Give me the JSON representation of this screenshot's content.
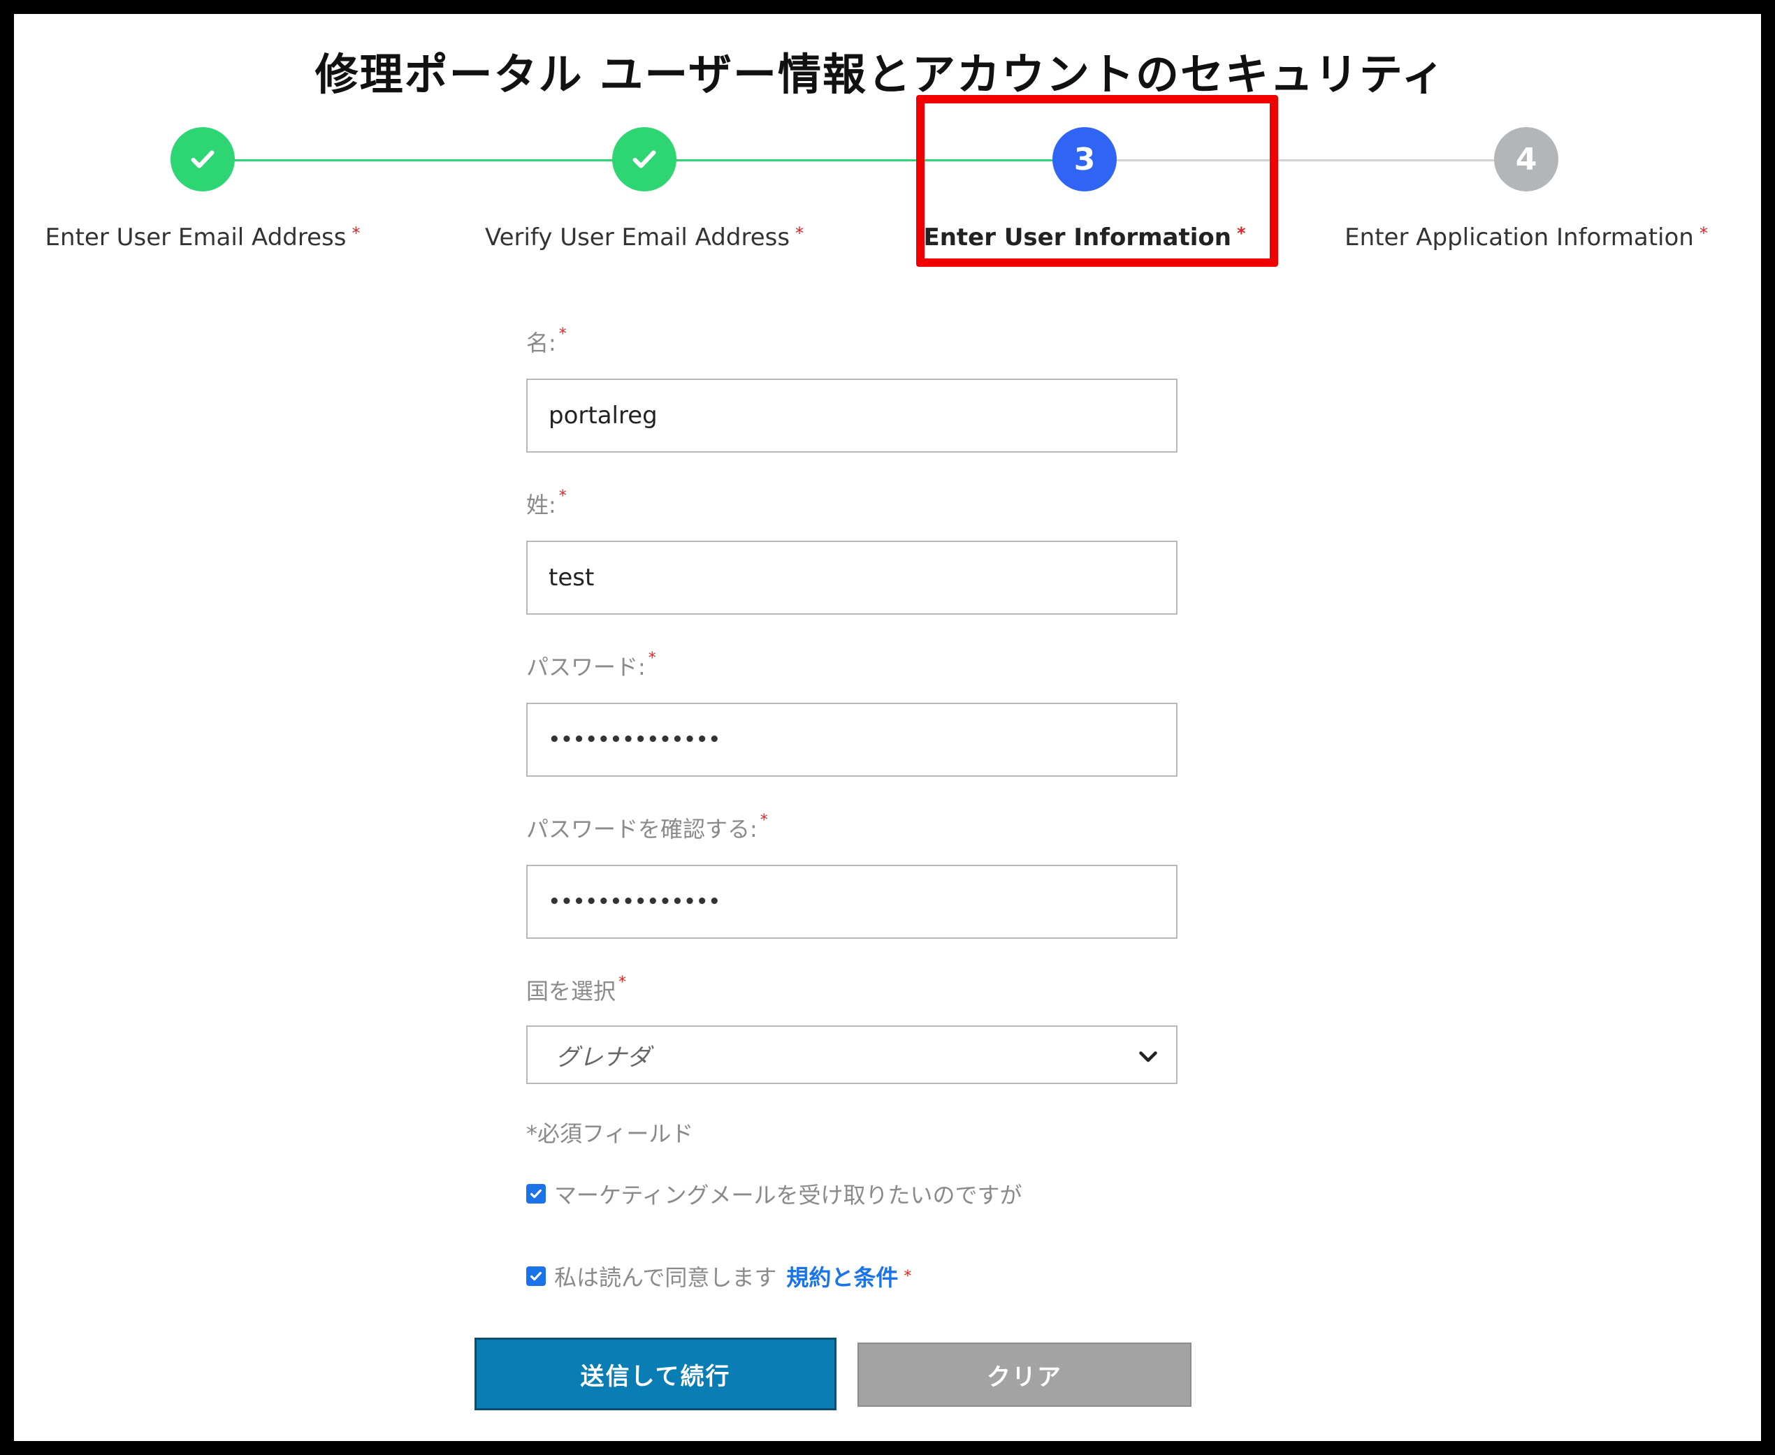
{
  "page": {
    "title": "修理ポータル ユーザー情報とアカウントのセキュリティ"
  },
  "stepper": {
    "required_mark": "*",
    "colors": {
      "done": "#2ed573",
      "active": "#2f64f5",
      "pending": "#b3b6b9"
    },
    "steps": [
      {
        "label": "Enter User Email Address",
        "status": "done",
        "icon": "check-icon"
      },
      {
        "label": "Verify User Email Address",
        "status": "done",
        "icon": "check-icon"
      },
      {
        "label": "Enter User Information",
        "number": "3",
        "status": "active"
      },
      {
        "label": "Enter Application Information",
        "number": "4",
        "status": "pending"
      }
    ]
  },
  "form": {
    "first_name": {
      "label": "名:",
      "value": "portalreg"
    },
    "last_name": {
      "label": "姓:",
      "value": "test"
    },
    "password": {
      "label": "パスワード:",
      "value": "••••••••••••••"
    },
    "confirm_password": {
      "label": "パスワードを確認する:",
      "value": "••••••••••••••"
    },
    "country": {
      "label": "国を選択",
      "value": "グレナダ"
    },
    "required_note": "*必須フィールド",
    "marketing_checkbox": {
      "label": "マーケティングメールを受け取りたいのですが",
      "checked": true
    },
    "terms_checkbox": {
      "label": "私は読んで同意します",
      "link": "規約と条件",
      "checked": true
    },
    "submit_button": "送信して続行",
    "clear_button": "クリア"
  }
}
